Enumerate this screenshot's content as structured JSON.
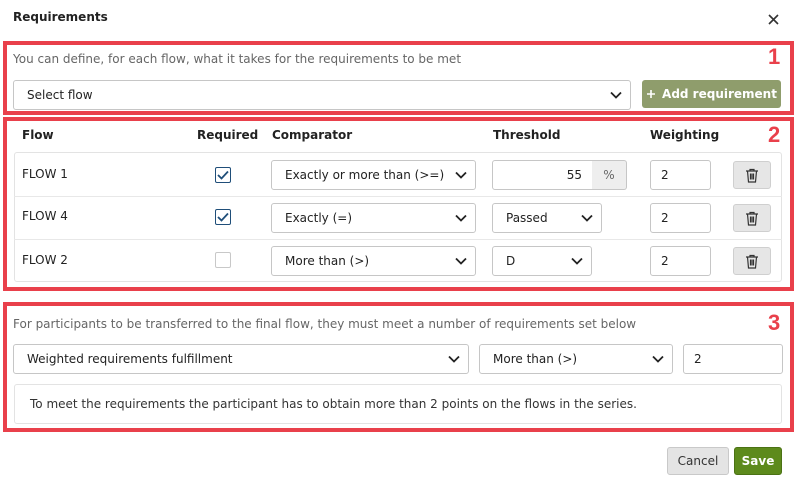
{
  "dialog": {
    "title": "Requirements",
    "close_icon": "close-icon"
  },
  "section1": {
    "number": "1",
    "description": "You can define, for each flow, what it takes for the requirements to be met",
    "flow_select": "Select flow",
    "add_button": "Add requirement",
    "add_icon": "plus-icon"
  },
  "section2": {
    "number": "2",
    "headers": {
      "flow": "Flow",
      "required": "Required",
      "comparator": "Comparator",
      "threshold": "Threshold",
      "weighting": "Weighting"
    },
    "rows": [
      {
        "flow": "FLOW 1",
        "required": true,
        "comparator": "Exactly or more than (>=)",
        "threshold": "55",
        "threshold_unit": "%",
        "weighting": "2"
      },
      {
        "flow": "FLOW 4",
        "required": true,
        "comparator": "Exactly (=)",
        "threshold": "Passed",
        "weighting": "2"
      },
      {
        "flow": "FLOW 2",
        "required": false,
        "comparator": "More than (>)",
        "threshold": "D",
        "weighting": "2"
      }
    ]
  },
  "section3": {
    "number": "3",
    "description": "For participants to be transferred to the final flow, they must meet a number of requirements set below",
    "mode_select": "Weighted requirements fulfillment",
    "comparator_select": "More than (>)",
    "value": "2",
    "info": "To meet the requirements the participant has to obtain more than 2 points on the flows in the series."
  },
  "footer": {
    "cancel": "Cancel",
    "save": "Save"
  },
  "colors": {
    "highlight": "#e9404b",
    "add_button": "#8f9d6c",
    "save_button": "#5d8a1c"
  }
}
